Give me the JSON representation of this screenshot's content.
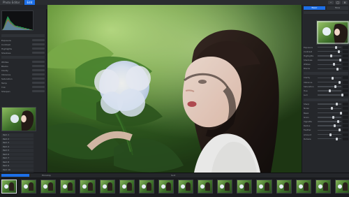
{
  "window": {
    "tabs": [
      "Photo Editor",
      "Edit"
    ]
  },
  "menu": {
    "items": [
      "File",
      "Edit",
      "View",
      "Image",
      "Export"
    ]
  },
  "left_panel": {
    "sections": [
      "Info",
      "Adjust"
    ],
    "rows": [
      "Exposure",
      "Contrast",
      "Highlights",
      "Shadows",
      "Whites",
      "Blacks",
      "Clarity",
      "Vibrance",
      "Saturation",
      "Temp",
      "Tint",
      "Sharpen"
    ],
    "list": [
      "Item 1",
      "Item 2",
      "Item 3",
      "Item 4",
      "Item 5",
      "Item 6",
      "Item 7",
      "Item 8",
      "Item 9",
      "Item 10",
      "Item 11"
    ]
  },
  "right_panel": {
    "tabs": [
      "Basic",
      "Tone"
    ],
    "sections": [
      "Light",
      "Color",
      "Detail"
    ],
    "sliders": [
      "Exposure",
      "Contrast",
      "Highlights",
      "Shadows",
      "Whites",
      "Blacks",
      "Clarity",
      "Vibrance",
      "Saturation",
      "Hue",
      "Lum",
      "Sharp",
      "Noise",
      "Mask",
      "Grain",
      "Vignette",
      "Radius",
      "Feather",
      "Amount",
      "Dehaze"
    ]
  },
  "filmstrip": {
    "header": [
      "Filmstrip",
      "Sort"
    ],
    "count": 18,
    "selected_index": 0
  },
  "colors": {
    "accent": "#1c6fe8",
    "panel_bg": "#25272b",
    "viewer_green": "#2f5a1f"
  }
}
